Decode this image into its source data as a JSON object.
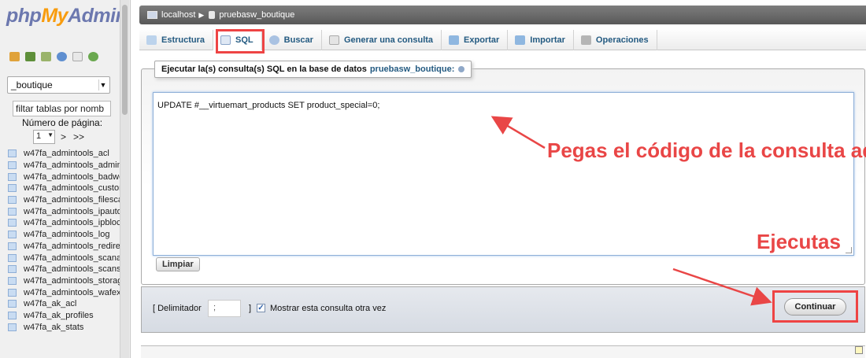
{
  "sidebar": {
    "logo": {
      "php": "php",
      "my": "My",
      "admin": "Admin"
    },
    "nav_icons": [
      "home-icon",
      "database-icon",
      "query-icon",
      "help-icon",
      "docs-icon",
      "reload-icon"
    ],
    "db_select": {
      "value": "_boutique"
    },
    "filter": {
      "value": "filtar tablas por nomb"
    },
    "page_label": "Número de página:",
    "page_select": {
      "value": "1"
    },
    "page_next": ">",
    "page_last": ">>",
    "tables": [
      "w47fa_admintools_acl",
      "w47fa_admintools_admin",
      "w47fa_admintools_badwo",
      "w47fa_admintools_custor",
      "w47fa_admintools_filesca",
      "w47fa_admintools_ipauto",
      "w47fa_admintools_ipbloc",
      "w47fa_admintools_log",
      "w47fa_admintools_redire",
      "w47fa_admintools_scana",
      "w47fa_admintools_scans",
      "w47fa_admintools_storag",
      "w47fa_admintools_wafex",
      "w47fa_ak_acl",
      "w47fa_ak_profiles",
      "w47fa_ak_stats"
    ]
  },
  "breadcrumb": {
    "server": "localhost",
    "database": "pruebasw_boutique"
  },
  "tabs": [
    {
      "label": "Estructura",
      "icon": "structure-icon"
    },
    {
      "label": "SQL",
      "icon": "sql-icon"
    },
    {
      "label": "Buscar",
      "icon": "search-icon"
    },
    {
      "label": "Generar una consulta",
      "icon": "query-builder-icon"
    },
    {
      "label": "Exportar",
      "icon": "export-icon"
    },
    {
      "label": "Importar",
      "icon": "import-icon"
    },
    {
      "label": "Operaciones",
      "icon": "wrench-icon"
    }
  ],
  "sql_panel": {
    "legend_prefix": "Ejecutar la(s) consulta(s) SQL en la base de datos",
    "legend_db": "pruebasw_boutique:",
    "query": "UPDATE #__virtuemart_products SET product_special=0;",
    "clear_label": "Limpiar"
  },
  "footer": {
    "delimiter_open": "[ Delimitador",
    "delimiter_value": ";",
    "delimiter_close": "]",
    "show_again_label": "Mostrar esta consulta otra vez",
    "show_again_checked": true,
    "continue_label": "Continuar"
  },
  "annotations": {
    "query_hint": "Pegas el código de la consulta aquí",
    "run_hint": "Ejecutas",
    "color": "#e94646"
  },
  "colors": {
    "link": "#235a81",
    "highlight": "#ee4444",
    "logo_blue": "#6c78af",
    "logo_orange": "#f89c0e"
  }
}
